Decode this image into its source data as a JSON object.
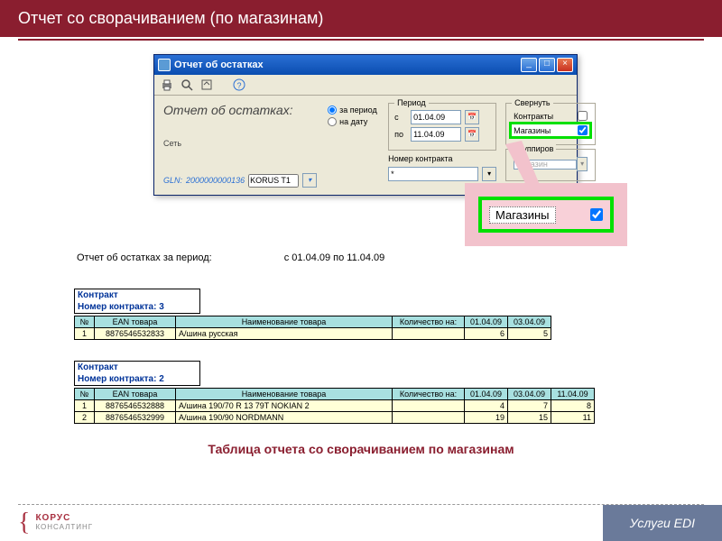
{
  "slide": {
    "title": "Отчет со сворачиванием (по магазинам)",
    "table_caption": "Таблица отчета со сворачиванием по магазинам"
  },
  "window": {
    "title": "Отчет об остатках",
    "report_label": "Отчет об остатках:",
    "gln_label": "GLN:",
    "gln_value": "2000000000136",
    "net_label": "Сеть",
    "net_value": "KORUS T1",
    "radio_period": "за период",
    "radio_date": "на дату",
    "fieldset_period": "Период",
    "fieldset_collapse": "Свернуть",
    "fieldset_group": "Группиров",
    "date_from_label": "с",
    "date_to_label": "по",
    "date_from": "01.04.09",
    "date_to": "11.04.09",
    "contract_label": "Номер контракта",
    "contract_value": "*",
    "chk_contracts": "Контракты",
    "chk_stores": "Магазины",
    "group_stores": "Магазин"
  },
  "callout": {
    "label": "Магазины"
  },
  "summary": {
    "label": "Отчет об остатках за период:",
    "range": "с 01.04.09 по 11.04.09"
  },
  "contract1": {
    "h1": "Контракт",
    "h2": "Номер контракта: 3",
    "headers": {
      "n": "№",
      "ean": "EAN товара",
      "name": "Наименование товара",
      "qty": "Количество на:",
      "d1": "01.04.09",
      "d2": "03.04.09"
    },
    "rows": [
      {
        "n": "1",
        "ean": "8876546532833",
        "name": "А/шина русская",
        "v1": "6",
        "v2": "5"
      }
    ]
  },
  "contract2": {
    "h1": "Контракт",
    "h2": "Номер контракта: 2",
    "headers": {
      "n": "№",
      "ean": "EAN товара",
      "name": "Наименование товара",
      "qty": "Количество на:",
      "d1": "01.04.09",
      "d2": "03.04.09",
      "d3": "11.04.09"
    },
    "rows": [
      {
        "n": "1",
        "ean": "8876546532888",
        "name": "А/шина 190/70 R 13 79T NOKIAN 2",
        "v1": "4",
        "v2": "7",
        "v3": "8"
      },
      {
        "n": "2",
        "ean": "8876546532999",
        "name": "А/шина 190/90 NORDMANN",
        "v1": "19",
        "v2": "15",
        "v3": "11"
      }
    ]
  },
  "footer": {
    "korus": "КОРУС",
    "consulting": "КОНСАЛТИНГ",
    "service": "Услуги EDI"
  }
}
